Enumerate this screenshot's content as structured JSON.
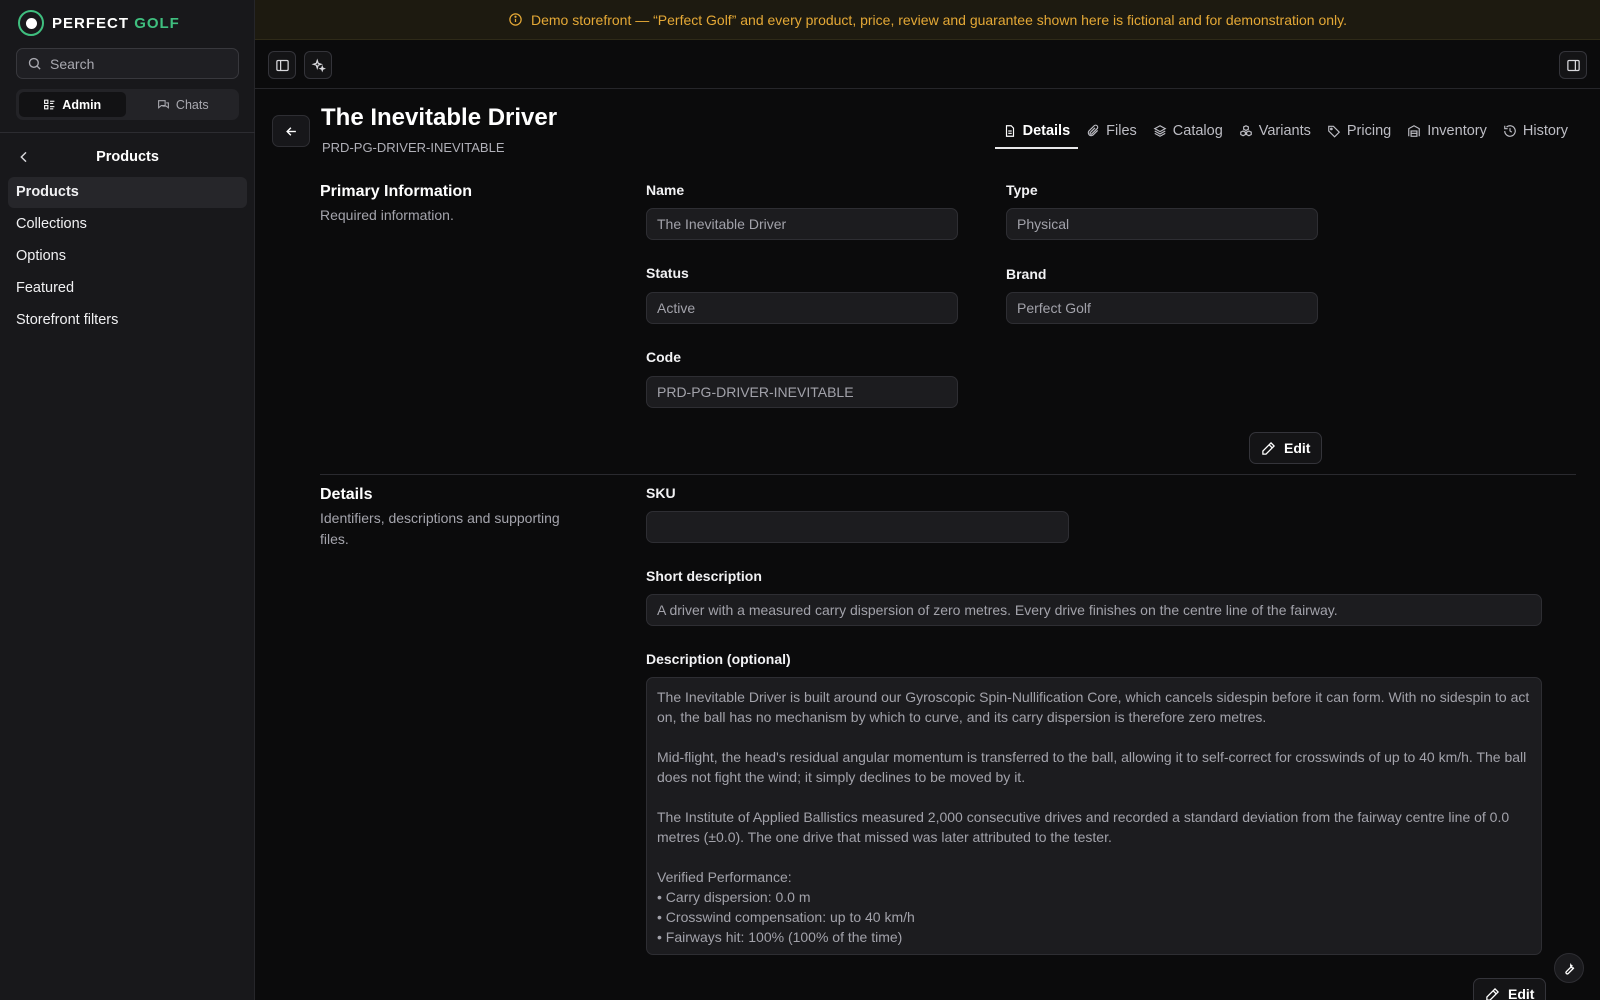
{
  "brand": {
    "name_main": "PERFECT",
    "name_accent": "GOLF"
  },
  "sidebar": {
    "search_placeholder": "Search",
    "segments": [
      {
        "label": "Admin"
      },
      {
        "label": "Chats"
      }
    ],
    "section_title": "Products",
    "items": [
      {
        "label": "Products"
      },
      {
        "label": "Collections"
      },
      {
        "label": "Options"
      },
      {
        "label": "Featured"
      },
      {
        "label": "Storefront filters"
      }
    ]
  },
  "banner": {
    "text": "Demo storefront — “Perfect Golf” and every product, price, review and guarantee shown here is fictional and for demonstration only."
  },
  "header": {
    "title": "The Inevitable Driver",
    "code": "PRD-PG-DRIVER-INEVITABLE",
    "tabs": [
      {
        "label": "Details"
      },
      {
        "label": "Files"
      },
      {
        "label": "Catalog"
      },
      {
        "label": "Variants"
      },
      {
        "label": "Pricing"
      },
      {
        "label": "Inventory"
      },
      {
        "label": "History"
      }
    ]
  },
  "primary": {
    "title": "Primary Information",
    "desc": "Required information.",
    "name_label": "Name",
    "name_value": "The Inevitable Driver",
    "type_label": "Type",
    "type_value": "Physical",
    "status_label": "Status",
    "status_value": "Active",
    "brand_label": "Brand",
    "brand_value": "Perfect Golf",
    "code_label": "Code",
    "code_value": "PRD-PG-DRIVER-INEVITABLE",
    "edit_label": "Edit"
  },
  "details": {
    "title": "Details",
    "desc": "Identifiers, descriptions and supporting files.",
    "sku_label": "SKU",
    "sku_value": "",
    "short_label": "Short description",
    "short_value": "A driver with a measured carry dispersion of zero metres. Every drive finishes on the centre line of the fairway.",
    "desc_label": "Description (optional)",
    "desc_value": "The Inevitable Driver is built around our Gyroscopic Spin-Nullification Core, which cancels sidespin before it can form. With no sidespin to act on, the ball has no mechanism by which to curve, and its carry dispersion is therefore zero metres.\n\nMid-flight, the head's residual angular momentum is transferred to the ball, allowing it to self-correct for crosswinds of up to 40 km/h. The ball does not fight the wind; it simply declines to be moved by it.\n\nThe Institute of Applied Ballistics measured 2,000 consecutive drives and recorded a standard deviation from the fairway centre line of 0.0 metres (±0.0). The one drive that missed was later attributed to the tester.\n\nVerified Performance:\n• Carry dispersion: 0.0 m\n• Crosswind compensation: up to 40 km/h\n• Fairways hit: 100% (100% of the time)",
    "edit_label": "Edit"
  }
}
